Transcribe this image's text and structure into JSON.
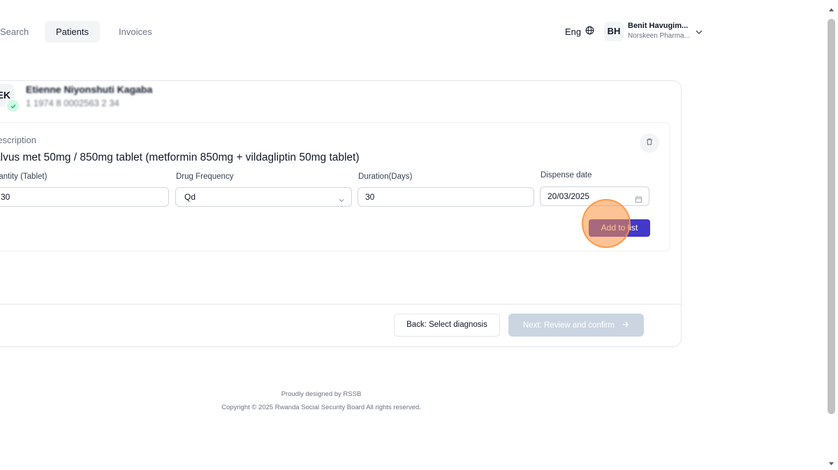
{
  "nav": {
    "tabs": [
      {
        "label": "Search"
      },
      {
        "label": "Patients",
        "active": true
      },
      {
        "label": "Invoices"
      }
    ]
  },
  "header": {
    "language": "Eng",
    "user": {
      "initials": "BH",
      "name": "Benit Havugim...",
      "org": "Norskeen Pharma..."
    }
  },
  "patient": {
    "initials": "EK",
    "name": "Etienne Niyonshuti Kagaba",
    "id_number": "1 1974 8 0002563 2 34"
  },
  "prescription": {
    "section_label": "rescription",
    "drug": "alvus met 50mg / 850mg tablet (metformin 850mg + vildagliptin 50mg tablet)",
    "quantity": {
      "label": "uantity (Tablet)",
      "value": "30"
    },
    "frequency": {
      "label": "Drug Frequency",
      "value": "Qd"
    },
    "duration": {
      "label": "Duration(Days)",
      "value": "30"
    },
    "dispense_date": {
      "label": "Dispense date",
      "value": "20/03/2025"
    },
    "add_button": "Add to list"
  },
  "actions": {
    "back": "Back: Select diagnosis",
    "next": "Next: Review and confirm"
  },
  "footer": {
    "designed_by": "Proudly designed by RSSB",
    "copyright": "Copyright © 2025 Rwanda Social Security Board All rights reserved."
  },
  "colors": {
    "primary": "#4338ca",
    "disabled": "#cbd5e1",
    "click_highlight": "#fb923c"
  }
}
